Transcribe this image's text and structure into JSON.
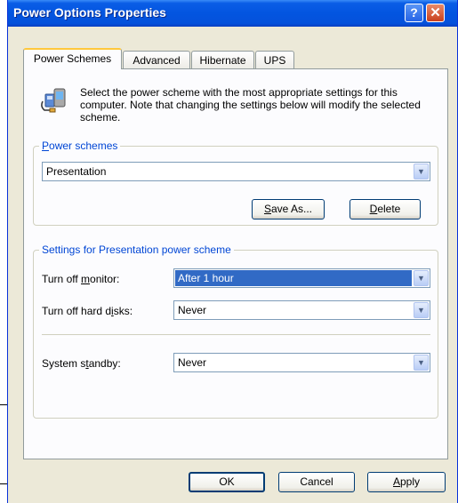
{
  "window": {
    "title": "Power Options Properties"
  },
  "titlebar": {
    "help_glyph": "?",
    "close_glyph": "✕"
  },
  "tabs": [
    {
      "label": "Power Schemes",
      "active": true
    },
    {
      "label": "Advanced",
      "active": false
    },
    {
      "label": "Hibernate",
      "active": false
    },
    {
      "label": "UPS",
      "active": false
    }
  ],
  "intro": {
    "icon": "power-scheme-icon",
    "text": "Select the power scheme with the most appropriate settings for this computer. Note that changing the settings below will modify the selected scheme."
  },
  "power_schemes": {
    "legend_pre": "P",
    "legend_rest": "ower schemes",
    "selected": "Presentation",
    "save_as_pre": "S",
    "save_as_rest": "ave As...",
    "delete_pre": "D",
    "delete_rest": "elete"
  },
  "settings": {
    "legend": "Settings for Presentation power scheme",
    "monitor": {
      "label_pre": "Turn off ",
      "label_ul": "m",
      "label_post": "onitor:",
      "value": "After 1 hour"
    },
    "hard_disks": {
      "label_pre": "Turn off hard d",
      "label_ul": "i",
      "label_post": "sks:",
      "value": "Never"
    },
    "standby": {
      "label_pre": "System s",
      "label_ul": "t",
      "label_post": "andby:",
      "value": "Never"
    }
  },
  "footer": {
    "ok": "OK",
    "cancel": "Cancel",
    "apply_pre": "A",
    "apply_rest": "pply"
  },
  "colors": {
    "titlebar": "#0355E0",
    "dialog_bg": "#ECE9D8",
    "selection": "#316AC5",
    "legend_text": "#0046D5"
  }
}
